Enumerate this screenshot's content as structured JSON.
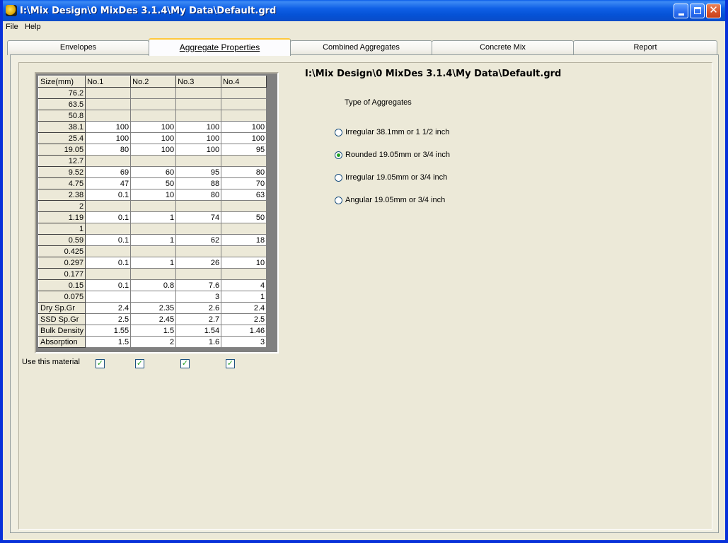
{
  "window": {
    "title": "I:\\Mix Design\\0 MixDes 3.1.4\\My Data\\Default.grd"
  },
  "menu": [
    "File",
    "Help"
  ],
  "tabs": [
    {
      "label": "Envelopes"
    },
    {
      "label": "Aggregate Properties",
      "active": true
    },
    {
      "label": "Combined Aggregates"
    },
    {
      "label": "Concrete Mix"
    },
    {
      "label": "Report"
    }
  ],
  "grid": {
    "corner": "Size(mm)",
    "columns": [
      "No.1",
      "No.2",
      "No.3",
      "No.4"
    ],
    "rows": [
      {
        "label": "76.2",
        "values": [
          "",
          "",
          "",
          ""
        ],
        "shaded": true
      },
      {
        "label": "63.5",
        "values": [
          "",
          "",
          "",
          ""
        ],
        "shaded": true
      },
      {
        "label": "50.8",
        "values": [
          "",
          "",
          "",
          ""
        ],
        "shaded": true
      },
      {
        "label": "38.1",
        "values": [
          "100",
          "100",
          "100",
          "100"
        ]
      },
      {
        "label": "25.4",
        "values": [
          "100",
          "100",
          "100",
          "100"
        ]
      },
      {
        "label": "19.05",
        "values": [
          "80",
          "100",
          "100",
          "95"
        ]
      },
      {
        "label": "12.7",
        "values": [
          "",
          "",
          "",
          ""
        ],
        "shaded": true
      },
      {
        "label": "9.52",
        "values": [
          "69",
          "60",
          "95",
          "80"
        ]
      },
      {
        "label": "4.75",
        "values": [
          "47",
          "50",
          "88",
          "70"
        ]
      },
      {
        "label": "2.38",
        "values": [
          "0.1",
          "10",
          "80",
          "63"
        ]
      },
      {
        "label": "2",
        "values": [
          "",
          "",
          "",
          ""
        ],
        "shaded": true
      },
      {
        "label": "1.19",
        "values": [
          "0.1",
          "1",
          "74",
          "50"
        ]
      },
      {
        "label": "1",
        "values": [
          "",
          "",
          "",
          ""
        ],
        "shaded": true
      },
      {
        "label": "0.59",
        "values": [
          "0.1",
          "1",
          "62",
          "18"
        ]
      },
      {
        "label": "0.425",
        "values": [
          "",
          "",
          "",
          ""
        ],
        "shaded": true
      },
      {
        "label": "0.297",
        "values": [
          "0.1",
          "1",
          "26",
          "10"
        ]
      },
      {
        "label": "0.177",
        "values": [
          "",
          "",
          "",
          ""
        ],
        "shaded": true
      },
      {
        "label": "0.15",
        "values": [
          "0.1",
          "0.8",
          "7.6",
          "4"
        ]
      },
      {
        "label": "0.075",
        "values": [
          "",
          "",
          "3",
          "1"
        ]
      }
    ],
    "properties": [
      {
        "label": "Dry Sp.Gr",
        "values": [
          "2.4",
          "2.35",
          "2.6",
          "2.4"
        ]
      },
      {
        "label": "SSD Sp.Gr",
        "values": [
          "2.5",
          "2.45",
          "2.7",
          "2.5"
        ]
      },
      {
        "label": "Bulk Density",
        "values": [
          "1.55",
          "1.5",
          "1.54",
          "1.46"
        ]
      },
      {
        "label": "Absorption",
        "values": [
          "1.5",
          "2",
          "1.6",
          "3"
        ]
      }
    ]
  },
  "use_material": {
    "label": "Use this material",
    "checked": [
      true,
      true,
      true,
      true
    ]
  },
  "file_path": "I:\\Mix Design\\0 MixDes 3.1.4\\My Data\\Default.grd",
  "aggregate_type": {
    "label": "Type of Aggregates",
    "options": [
      {
        "label": "Irregular 38.1mm or 1 1/2 inch",
        "selected": false
      },
      {
        "label": "Rounded 19.05mm or 3/4 inch",
        "selected": true
      },
      {
        "label": "Irregular 19.05mm or 3/4 inch",
        "selected": false
      },
      {
        "label": "Angular 19.05mm or 3/4 inch",
        "selected": false
      }
    ]
  }
}
